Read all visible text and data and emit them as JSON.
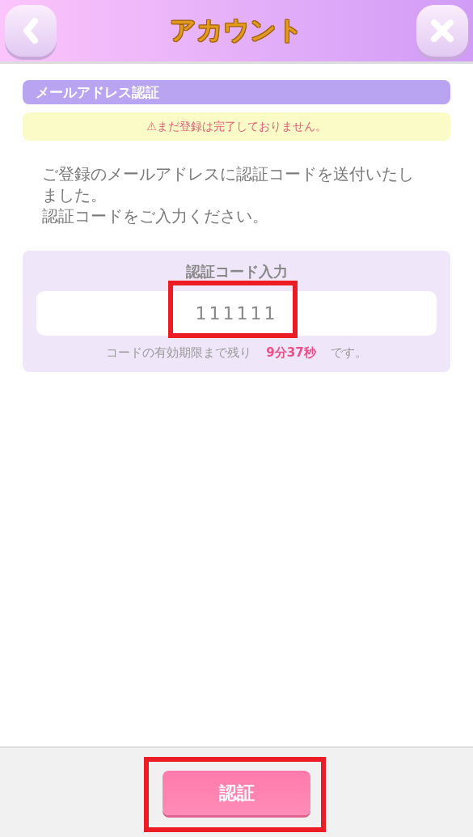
{
  "header": {
    "title": "アカウント"
  },
  "section": {
    "title": "メールアドレス認証"
  },
  "warning": {
    "icon": "⚠",
    "text": "まだ登録は完了しておりません。"
  },
  "message": [
    "ご登録のメールアドレスに認証コードを送付いたしました。",
    "認証コードをご入力ください。"
  ],
  "code_panel": {
    "label": "認証コード入力",
    "field": {
      "value": "111111",
      "highlighted": true
    },
    "expiry": {
      "prefix": "コードの有効期限まで残り",
      "remaining": "9分37秒",
      "suffix": "です。"
    }
  },
  "submit_button": {
    "label": "認証",
    "highlighted": true
  }
}
